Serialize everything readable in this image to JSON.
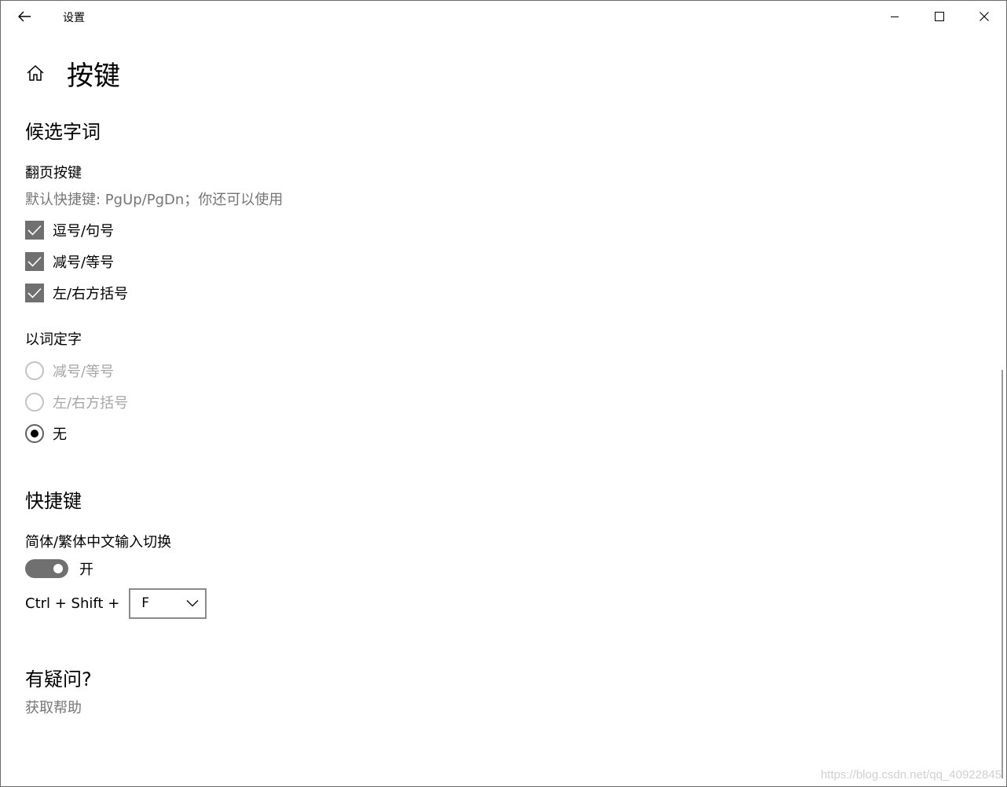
{
  "window": {
    "title": "设置"
  },
  "page": {
    "title": "按键"
  },
  "candidates": {
    "section_title": "候选字词",
    "paging_label": "翻页按键",
    "paging_desc": "默认快捷键: PgUp/PgDn；你还可以使用",
    "checkboxes": [
      {
        "label": "逗号/句号",
        "checked": true
      },
      {
        "label": "减号/等号",
        "checked": true
      },
      {
        "label": "左/右方括号",
        "checked": true
      }
    ],
    "word_label": "以词定字",
    "radios": [
      {
        "label": "减号/等号",
        "selected": false
      },
      {
        "label": "左/右方括号",
        "selected": false
      },
      {
        "label": "无",
        "selected": true
      }
    ]
  },
  "shortcuts": {
    "section_title": "快捷键",
    "switch_label": "简体/繁体中文输入切换",
    "toggle_state": "开",
    "toggle_on": true,
    "combo_prefix": "Ctrl + Shift +",
    "combo_key": "F"
  },
  "help": {
    "title": "有疑问?",
    "link": "获取帮助"
  },
  "watermark": "https://blog.csdn.net/qq_40922845",
  "icons": {
    "back": "back-arrow-icon",
    "home": "home-icon",
    "minimize": "minimize-icon",
    "maximize": "maximize-icon",
    "close": "close-icon",
    "check": "check-icon",
    "dropdown": "chevron-down-icon"
  },
  "colors": {
    "checkbox_fill": "#707070",
    "toggle_fill": "#707070",
    "secondary_text": "#767676",
    "disabled_text": "#a6a6a6"
  }
}
